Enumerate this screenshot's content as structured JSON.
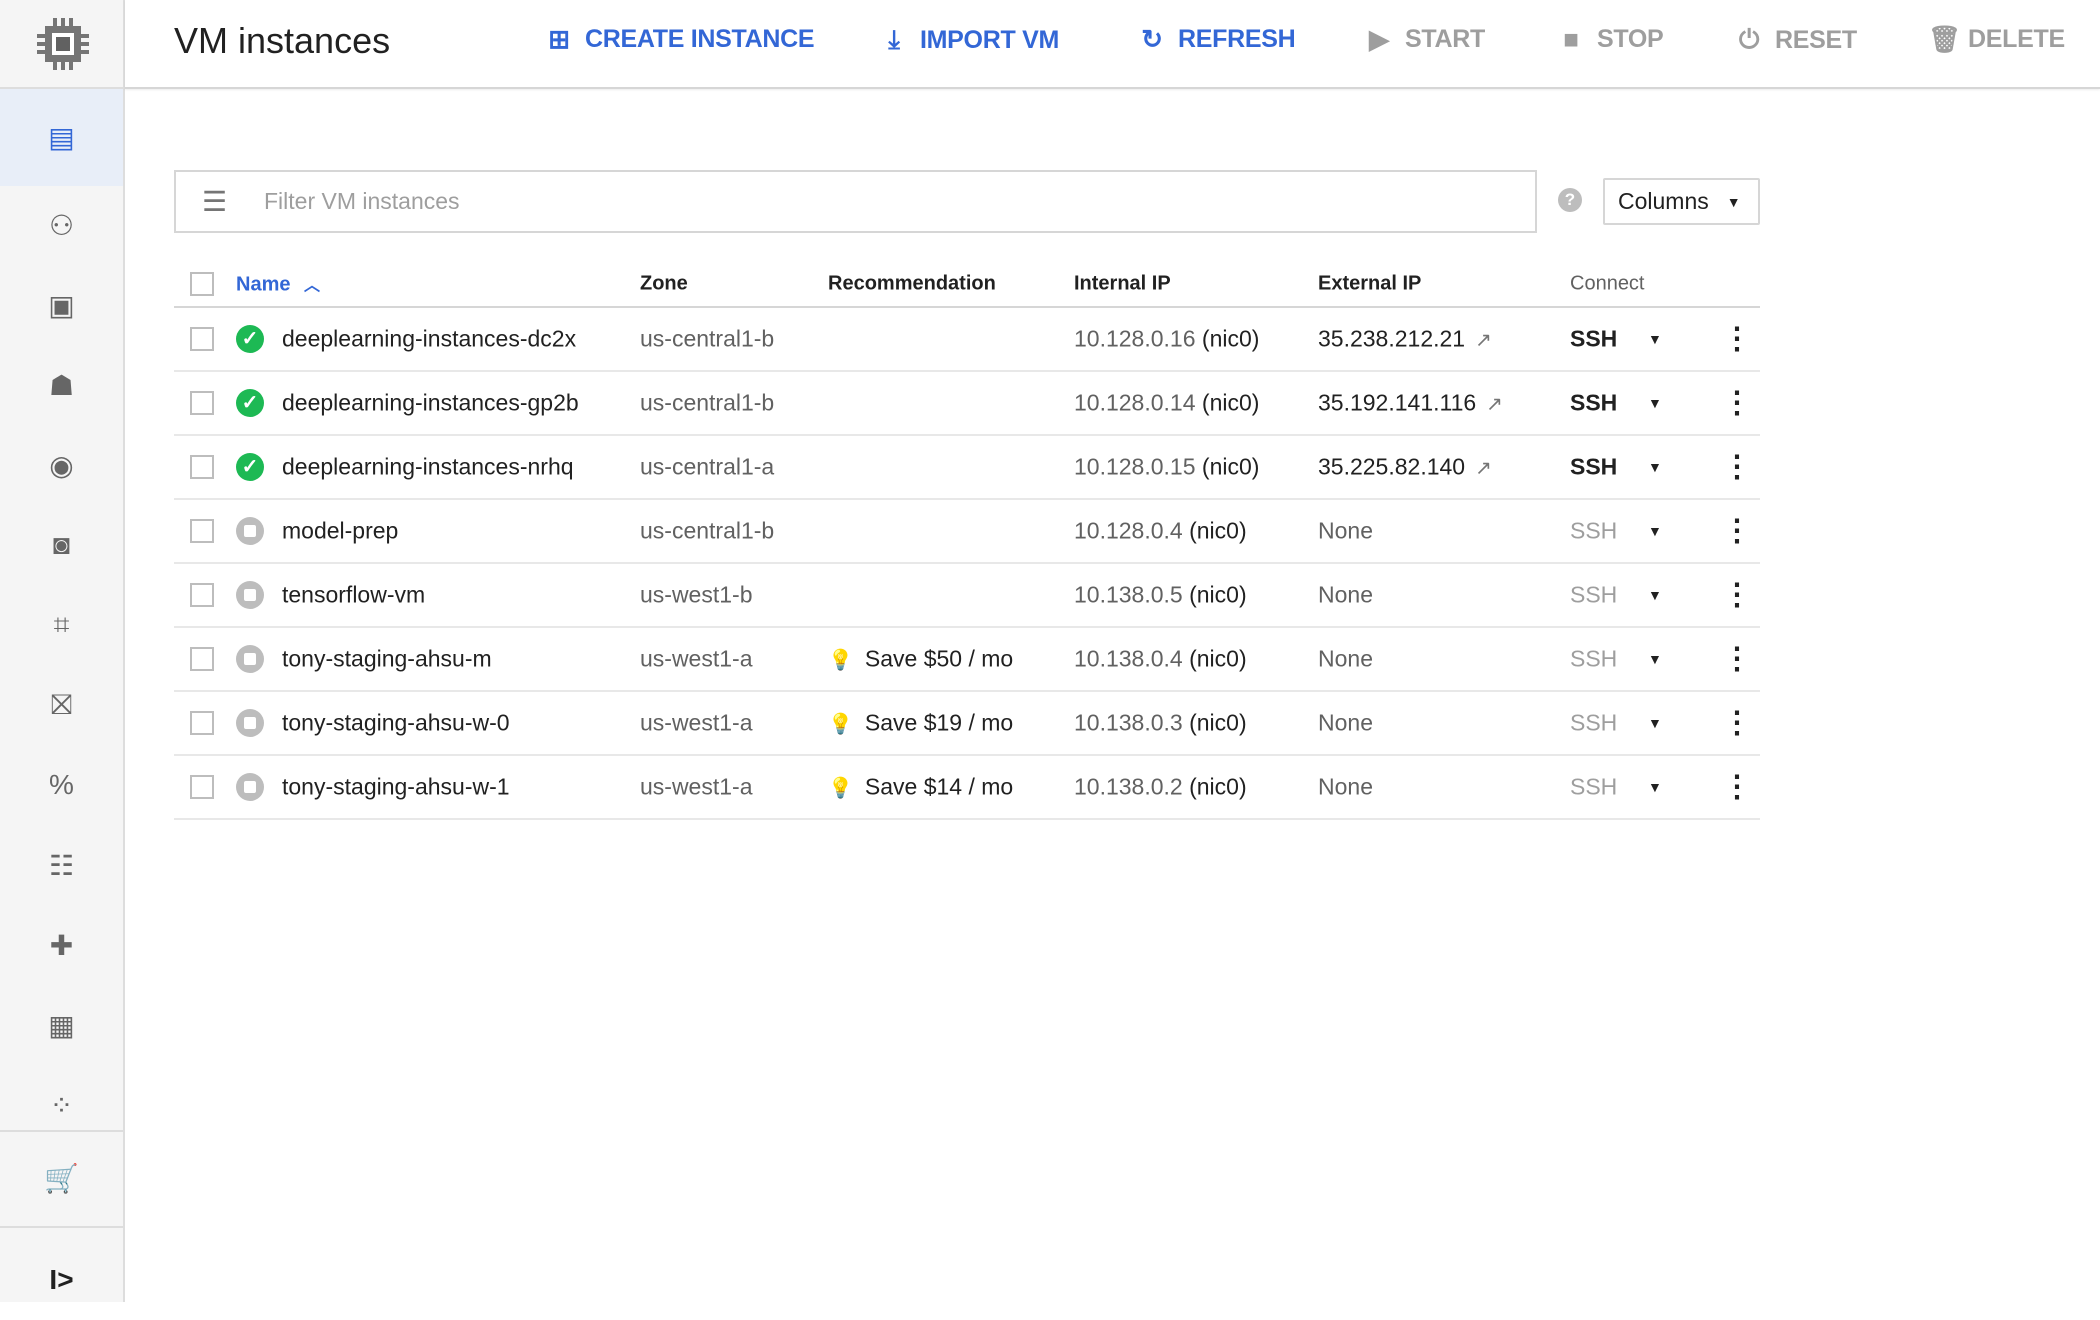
{
  "header": {
    "title": "VM instances",
    "actions": [
      {
        "label": "CREATE INSTANCE",
        "icon": "add-box-icon",
        "enabled": true
      },
      {
        "label": "IMPORT VM",
        "icon": "download-icon",
        "enabled": true
      },
      {
        "label": "REFRESH",
        "icon": "refresh-icon",
        "enabled": true
      },
      {
        "label": "START",
        "icon": "play-icon",
        "enabled": false
      },
      {
        "label": "STOP",
        "icon": "stop-icon",
        "enabled": false
      },
      {
        "label": "RESET",
        "icon": "power-icon",
        "enabled": false
      },
      {
        "label": "DELETE",
        "icon": "trash-icon",
        "enabled": false
      }
    ]
  },
  "sidebar": {
    "items": [
      "vm-instances",
      "instance-groups",
      "instance-templates",
      "sole-tenant-nodes",
      "disks",
      "snapshots",
      "images",
      "tpus",
      "committed-use-discounts",
      "metadata",
      "health-checks",
      "zones",
      "network-endpoint-groups",
      "marketplace"
    ],
    "active": "vm-instances"
  },
  "filter": {
    "placeholder": "Filter VM instances",
    "value": ""
  },
  "columns_button": "Columns",
  "table": {
    "headers": {
      "name": "Name",
      "zone": "Zone",
      "recommendation": "Recommendation",
      "internal_ip": "Internal IP",
      "external_ip": "External IP",
      "connect": "Connect"
    },
    "sort": "Name ascending",
    "rows": [
      {
        "name": "deeplearning-instances-dc2x",
        "status": "running",
        "zone": "us-central1-b",
        "recommendation": "",
        "internal_ip": "10.128.0.16",
        "nic": "(nic0)",
        "external_ip": "35.238.212.21",
        "connect": "SSH"
      },
      {
        "name": "deeplearning-instances-gp2b",
        "status": "running",
        "zone": "us-central1-b",
        "recommendation": "",
        "internal_ip": "10.128.0.14",
        "nic": "(nic0)",
        "external_ip": "35.192.141.116",
        "connect": "SSH"
      },
      {
        "name": "deeplearning-instances-nrhq",
        "status": "running",
        "zone": "us-central1-a",
        "recommendation": "",
        "internal_ip": "10.128.0.15",
        "nic": "(nic0)",
        "external_ip": "35.225.82.140",
        "connect": "SSH"
      },
      {
        "name": "model-prep",
        "status": "stopped",
        "zone": "us-central1-b",
        "recommendation": "",
        "internal_ip": "10.128.0.4",
        "nic": "(nic0)",
        "external_ip": "None",
        "connect": "SSH"
      },
      {
        "name": "tensorflow-vm",
        "status": "stopped",
        "zone": "us-west1-b",
        "recommendation": "",
        "internal_ip": "10.138.0.5",
        "nic": "(nic0)",
        "external_ip": "None",
        "connect": "SSH"
      },
      {
        "name": "tony-staging-ahsu-m",
        "status": "stopped",
        "zone": "us-west1-a",
        "recommendation": "Save $50 / mo",
        "internal_ip": "10.138.0.4",
        "nic": "(nic0)",
        "external_ip": "None",
        "connect": "SSH"
      },
      {
        "name": "tony-staging-ahsu-w-0",
        "status": "stopped",
        "zone": "us-west1-a",
        "recommendation": "Save $19 / mo",
        "internal_ip": "10.138.0.3",
        "nic": "(nic0)",
        "external_ip": "None",
        "connect": "SSH"
      },
      {
        "name": "tony-staging-ahsu-w-1",
        "status": "stopped",
        "zone": "us-west1-a",
        "recommendation": "Save $14 / mo",
        "internal_ip": "10.138.0.2",
        "nic": "(nic0)",
        "external_ip": "None",
        "connect": "SSH"
      }
    ]
  },
  "colors": {
    "accent": "#3367d6",
    "running": "#1db954",
    "stopped": "#bdbdbd"
  }
}
